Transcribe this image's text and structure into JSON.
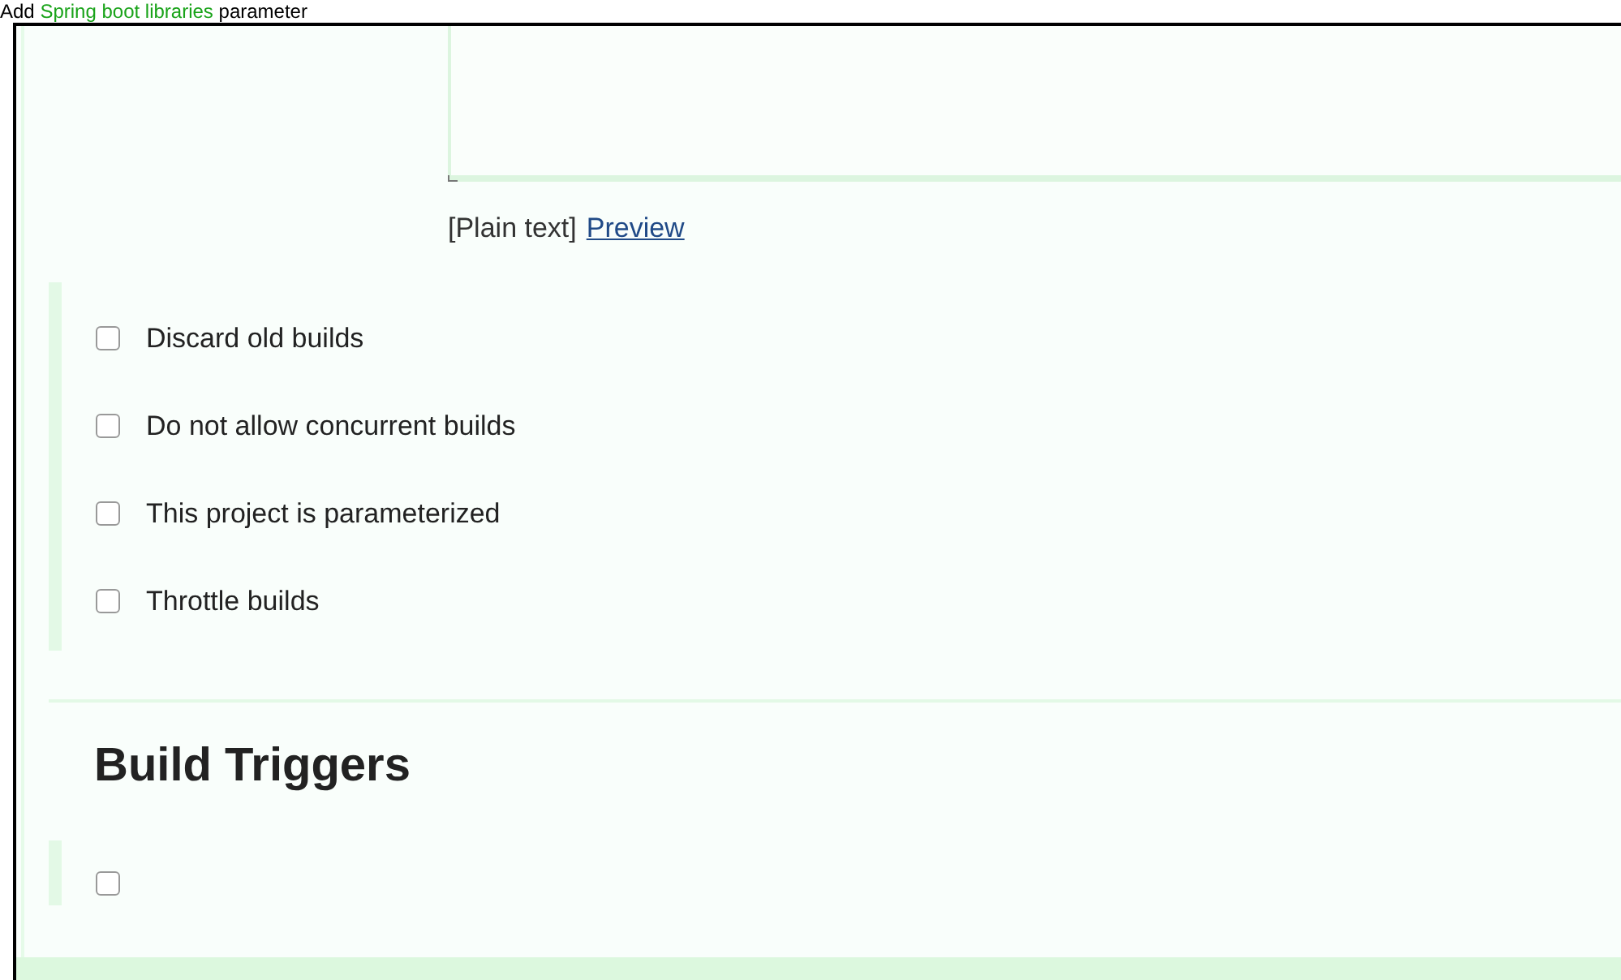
{
  "caption": {
    "before": "Add",
    "link": "Spring boot libraries",
    "after": "parameter"
  },
  "description": {
    "mode": "[Plain text]",
    "preview_link": "Preview"
  },
  "options": [
    {
      "label": "Discard old builds",
      "checked": false
    },
    {
      "label": "Do not allow concurrent builds",
      "checked": false
    },
    {
      "label": "This project is parameterized",
      "checked": false
    },
    {
      "label": "Throttle builds",
      "checked": false
    }
  ],
  "section": {
    "title": "Build Triggers",
    "options": [
      {
        "checked": false
      }
    ]
  }
}
